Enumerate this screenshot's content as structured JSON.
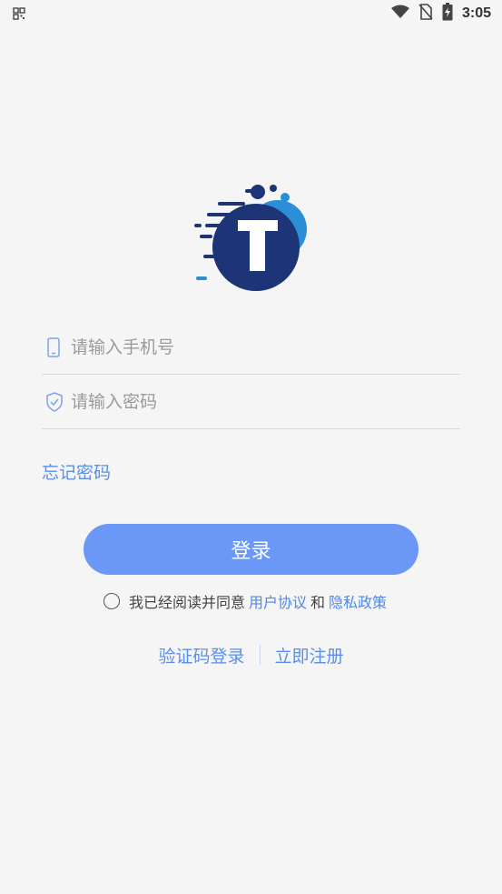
{
  "status_bar": {
    "time": "3:05",
    "icons": [
      "qr-grid-icon",
      "wifi-icon",
      "no-sim-icon",
      "battery-charging-icon"
    ]
  },
  "login": {
    "phone_placeholder": "请输入手机号",
    "password_placeholder": "请输入密码",
    "forgot_password": "忘记密码",
    "login_button": "登录",
    "agreement": {
      "prefix": "我已经阅读并同意",
      "user_agreement": "用户协议",
      "and": "和",
      "privacy_policy": "隐私政策"
    },
    "sms_login": "验证码登录",
    "register": "立即注册"
  },
  "colors": {
    "accent": "#6b97f7",
    "link": "#5b8ee8",
    "logo_dark": "#1d3577",
    "logo_light": "#2a8fd6",
    "background": "#f5f5f5"
  }
}
